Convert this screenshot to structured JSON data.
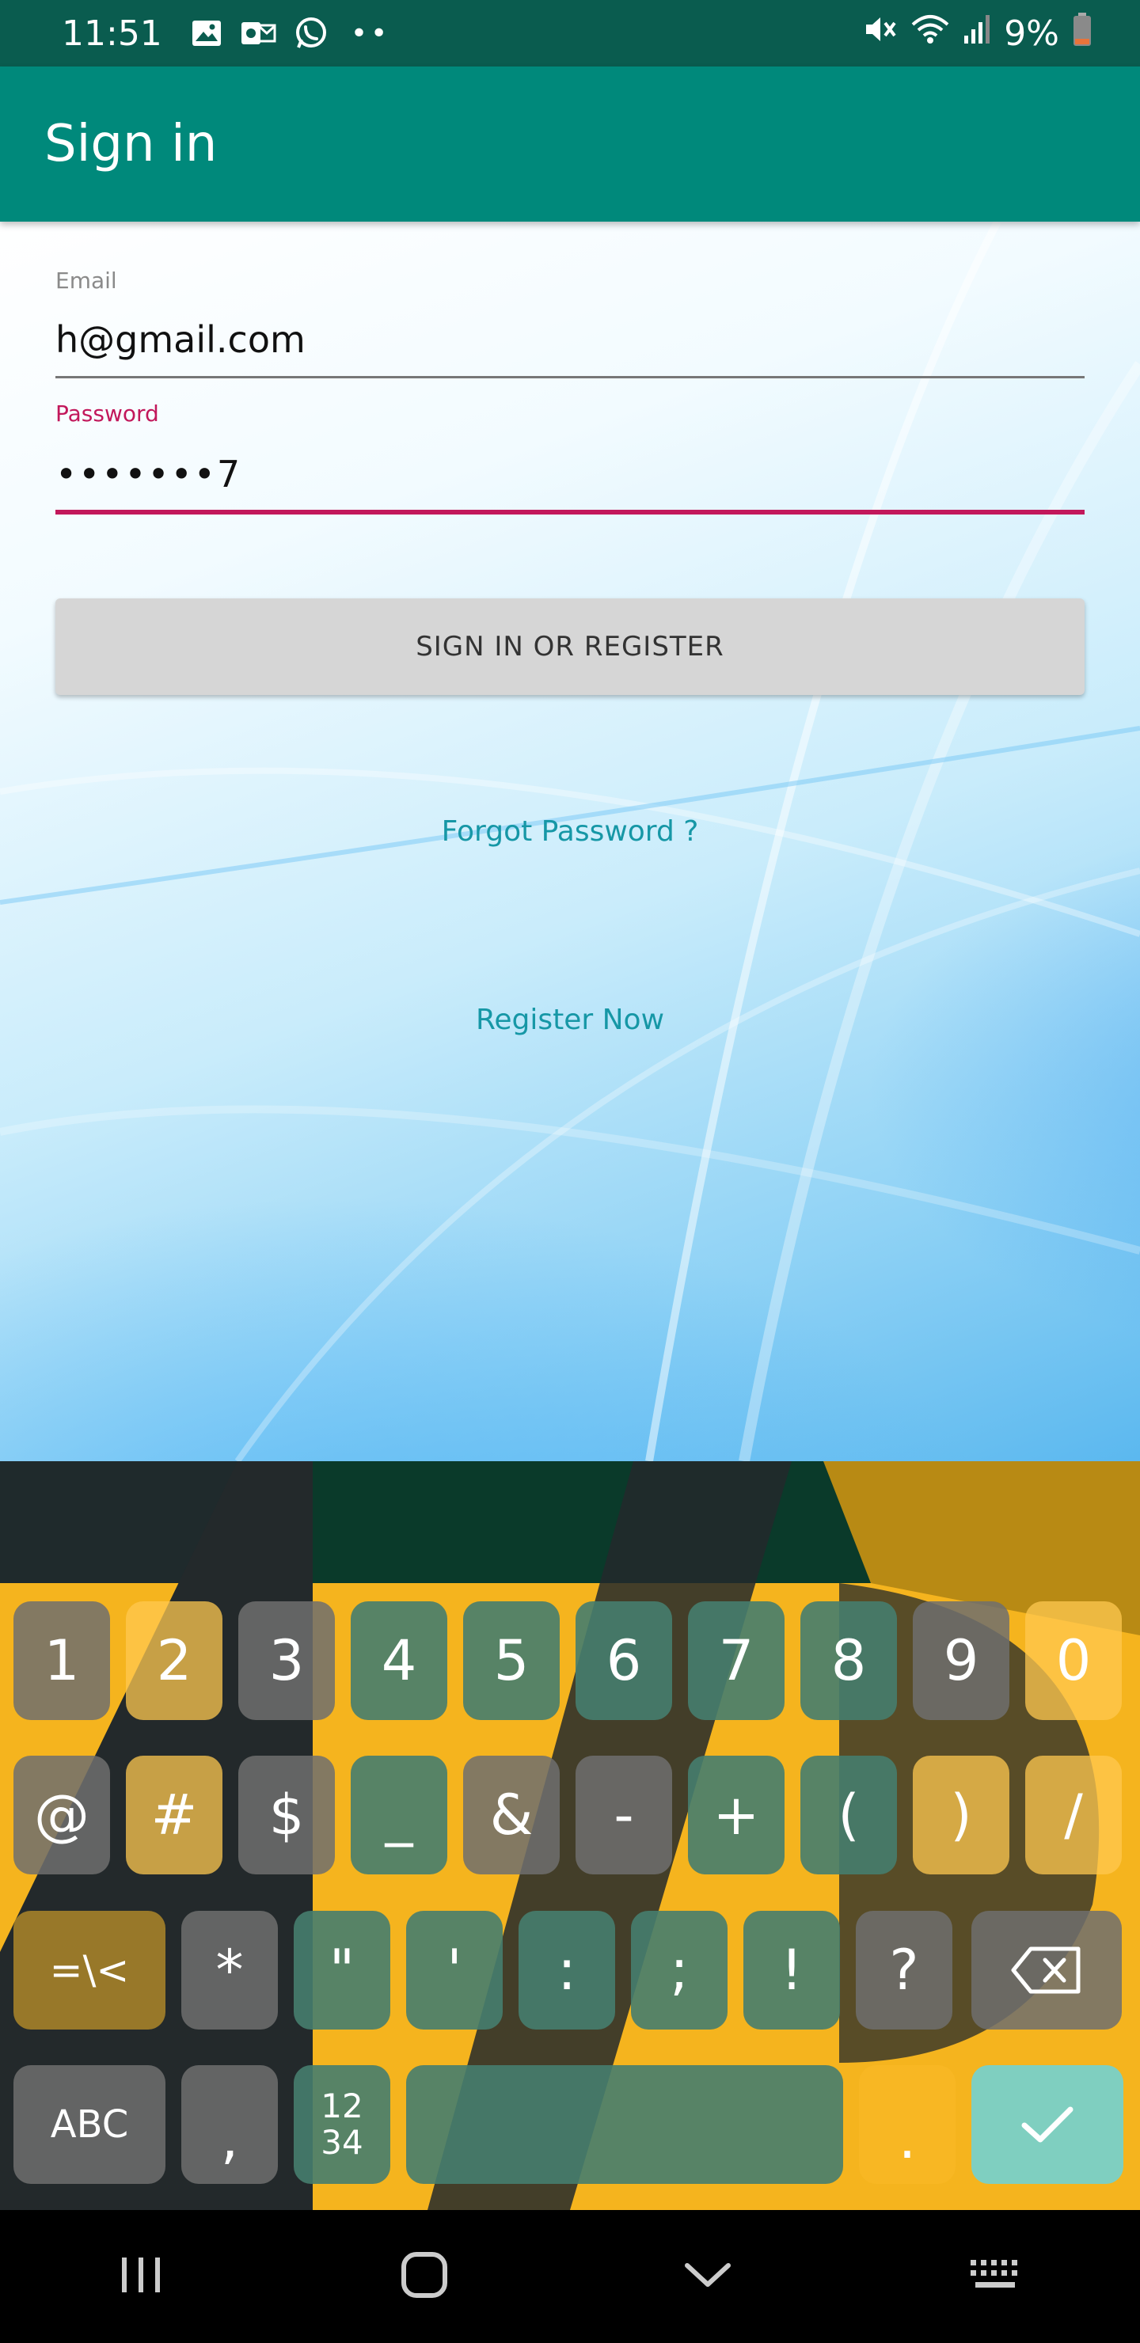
{
  "status_bar": {
    "time": "11:51",
    "battery_text": "9%",
    "notification_icons": [
      "image-icon",
      "outlook-icon",
      "whatsapp-icon"
    ],
    "more": "••"
  },
  "app_bar": {
    "title": "Sign in"
  },
  "form": {
    "email_label": "Email",
    "email_value": "h@gmail.com",
    "password_label": "Password",
    "password_value": "•••••••7",
    "submit_label": "SIGN IN OR REGISTER",
    "forgot_link": "Forgot Password ?",
    "register_link": "Register Now"
  },
  "keyboard": {
    "row1": [
      "1",
      "2",
      "3",
      "4",
      "5",
      "6",
      "7",
      "8",
      "9",
      "0"
    ],
    "row2": [
      "@",
      "#",
      "$",
      "_",
      "&",
      "-",
      "+",
      "(",
      ")",
      "/"
    ],
    "row3": [
      "=\\<",
      "*",
      "\"",
      "'",
      ":",
      ";",
      "!",
      "?"
    ],
    "row4": {
      "abc": "ABC",
      "comma": ",",
      "num_top": "12",
      "num_bottom": "34",
      "period": "."
    }
  },
  "colors": {
    "app_bar": "#00897b",
    "status_bar": "#0a5c4f",
    "accent": "#c2185b",
    "link": "#1697a6"
  }
}
